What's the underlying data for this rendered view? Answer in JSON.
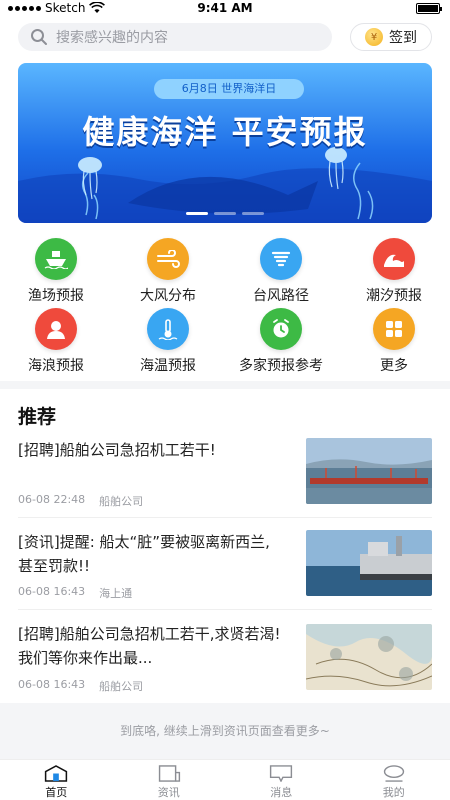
{
  "status_bar": {
    "carrier": "Sketch",
    "time": "9:41 AM"
  },
  "search": {
    "placeholder": "搜索感兴趣的内容",
    "icon": "search-icon"
  },
  "signin": {
    "label": "签到",
    "coin_glyph": "¥"
  },
  "banner": {
    "date_pill": "6月8日  世界海洋日",
    "headline": "健康海洋 平安预报",
    "indicator_count": 3,
    "active_index": 0
  },
  "functions": [
    {
      "label": "渔场预报",
      "icon": "ship-icon",
      "color": "#3dba45"
    },
    {
      "label": "大风分布",
      "icon": "wind-icon",
      "color": "#f5a623"
    },
    {
      "label": "台风路径",
      "icon": "typhoon-icon",
      "color": "#39a6f2"
    },
    {
      "label": "潮汐预报",
      "icon": "tide-icon",
      "color": "#ef4a3c"
    },
    {
      "label": "海浪预报",
      "icon": "wave-icon",
      "color": "#ef4a3c"
    },
    {
      "label": "海温预报",
      "icon": "thermometer-icon",
      "color": "#39a6f2"
    },
    {
      "label": "多家预报参考",
      "icon": "clock-icon",
      "color": "#3dba45"
    },
    {
      "label": "更多",
      "icon": "grid-icon",
      "color": "#f5a623"
    }
  ],
  "section": {
    "title": "推荐"
  },
  "news": [
    {
      "title": "[招聘]船舶公司急招机工若干!",
      "time": "06-08 22:48",
      "source": "船舶公司"
    },
    {
      "title": "[资讯]提醒: 船太“脏”要被驱离新西兰, 甚至罚款!!",
      "time": "06-08 16:43",
      "source": "海上通"
    },
    {
      "title": "[招聘]船舶公司急招机工若干,求贤若渴! 我们等你来作出最...",
      "time": "06-08 16:43",
      "source": "船舶公司"
    }
  ],
  "footer_note": "到底咯, 继续上滑到资讯页面查看更多~",
  "tabs": [
    {
      "label": "首页",
      "icon": "home-icon",
      "active": true
    },
    {
      "label": "资讯",
      "icon": "news-icon",
      "active": false
    },
    {
      "label": "消息",
      "icon": "message-icon",
      "active": false
    },
    {
      "label": "我的",
      "icon": "profile-icon",
      "active": false
    }
  ]
}
